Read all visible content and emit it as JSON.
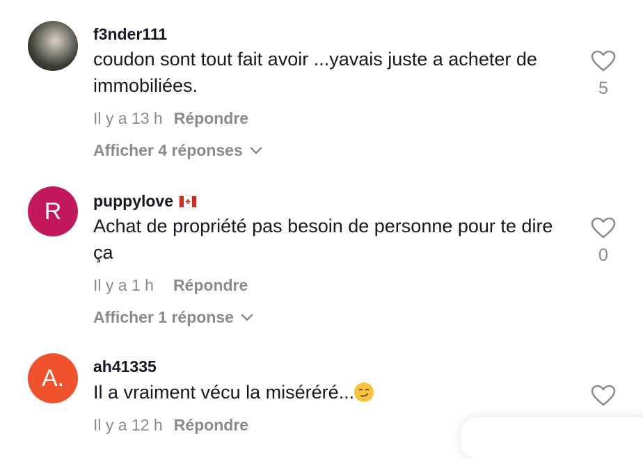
{
  "comments": [
    {
      "username": "f3nder111",
      "avatar_letter": "",
      "text": "coudon sont tout fait avoir ...yavais juste a acheter de immobiliées.",
      "time": "Il y a 13 h",
      "reply_label": "Répondre",
      "view_replies": "Afficher 4 réponses",
      "likes": "5"
    },
    {
      "username": "puppylove",
      "flag": "canada-flag",
      "avatar_letter": "R",
      "avatar_color": "#c2185b",
      "text": "Achat de propriété pas besoin de personne pour te dire ça",
      "time": "Il y a 1 h",
      "reply_label": "Répondre",
      "view_replies": "Afficher 1 réponse",
      "likes": "0"
    },
    {
      "username": "ah41335",
      "avatar_letter": "A.",
      "avatar_color": "#f0522d",
      "text": "Il a vraiment vécu la miséréré...",
      "emoji": "smirk-emoji",
      "time": "Il y a 12 h",
      "reply_label": "Répondre"
    }
  ],
  "icons": {
    "like": "heart-outline-icon",
    "expand": "chevron-down-icon"
  },
  "colors": {
    "text": "#161823",
    "muted": "#8a8b91"
  }
}
